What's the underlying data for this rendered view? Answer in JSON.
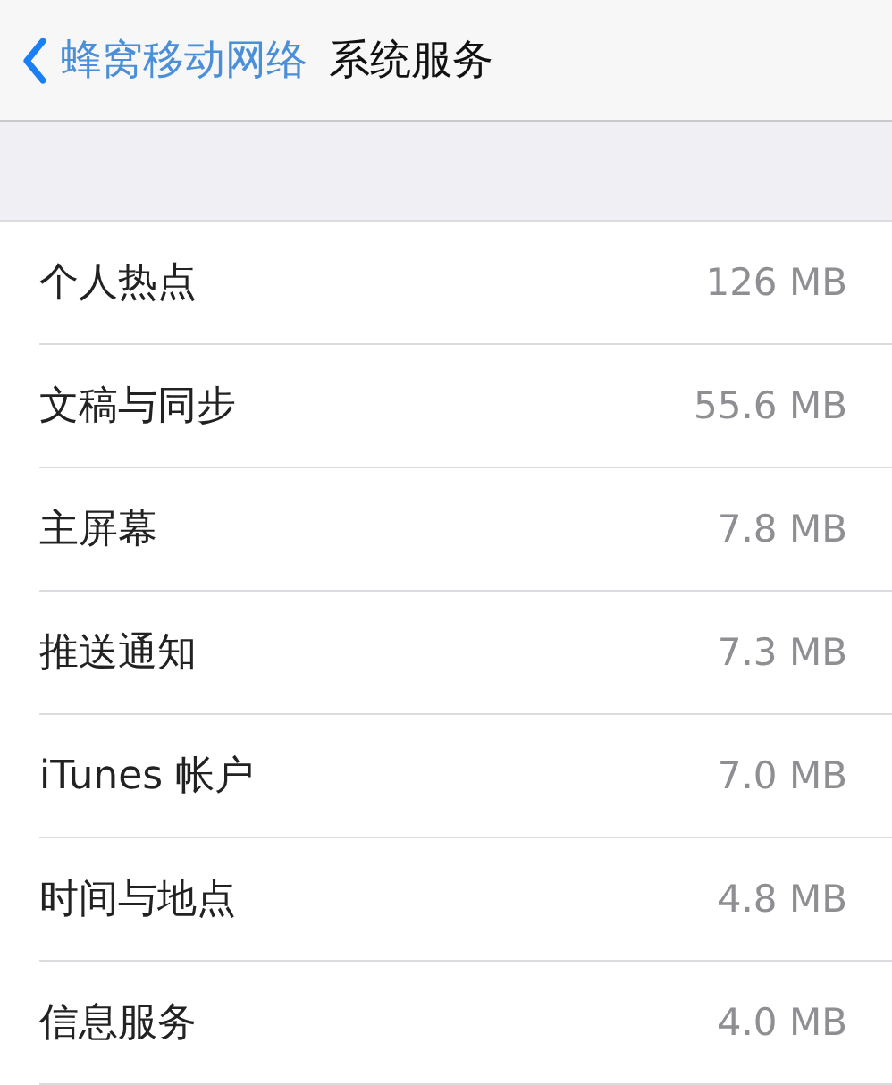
{
  "nav": {
    "back": "蜂窝移动网络",
    "title": "系统服务"
  },
  "rows": [
    {
      "label": "个人热点",
      "value": "126 MB"
    },
    {
      "label": "文稿与同步",
      "value": "55.6 MB"
    },
    {
      "label": "主屏幕",
      "value": "7.8 MB"
    },
    {
      "label": "推送通知",
      "value": "7.3 MB"
    },
    {
      "label": "iTunes 帐户",
      "value": "7.0 MB"
    },
    {
      "label": "时间与地点",
      "value": "4.8 MB"
    },
    {
      "label": "信息服务",
      "value": "4.0 MB"
    }
  ]
}
